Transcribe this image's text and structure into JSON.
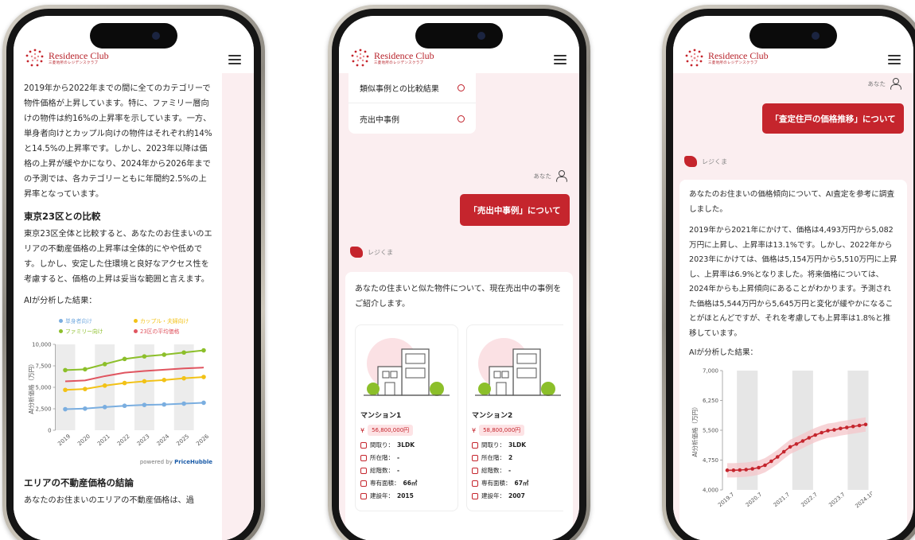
{
  "brand": {
    "title": "Residence Club",
    "subtitle": "三菱地所のレジデンスクラブ",
    "color": "#c5252d"
  },
  "phone1": {
    "intro": "2019年から2022年までの間に全てのカテゴリーで物件価格が上昇しています。特に、ファミリー層向けの物件は約16%の上昇率を示しています。一方、単身者向けとカップル向けの物件はそれぞれ約14%と14.5%の上昇率です。しかし、2023年以降は価格の上昇が緩やかになり、2024年から2026年までの予測では、各カテゴリーともに年間約2.5%の上昇率となっています。",
    "section1_title": "東京23区との比較",
    "section1_text": "東京23区全体と比較すると、あなたのお住まいのエリアの不動産価格の上昇率は全体的にやや低めです。しかし、安定した住環境と良好なアクセス性を考慮すると、価格の上昇は妥当な範囲と言えます。",
    "analysis_label": "AIが分析した結果：",
    "powered_by": "powered by",
    "powered_brand": "PriceHubble",
    "section2_title": "エリアの不動産価格の結論",
    "section2_text": "あなたのお住まいのエリアの不動産価格は、過"
  },
  "phone2": {
    "menu_items": [
      "類似事例との比較結果",
      "売出中事例"
    ],
    "you_label": "あなた",
    "user_message": "「売出中事例」について",
    "bot_name": "レジくま",
    "bot_message": "あなたの住まいと似た物件について、現在売出中の事例をご紹介します。",
    "properties": [
      {
        "name": "マンション1",
        "price": "56,800,000円",
        "layout_label": "間取り：",
        "layout": "3LDK",
        "floor_label": "所在階：",
        "floor": "-",
        "total_floors_label": "総階数：",
        "total_floors": "-",
        "area_label": "専有面積：",
        "area": "66㎡",
        "built_label": "建設年：",
        "built": "2015"
      },
      {
        "name": "マンション2",
        "price": "58,800,000円",
        "layout_label": "間取り：",
        "layout": "3LDK",
        "floor_label": "所在階：",
        "floor": "2",
        "total_floors_label": "総階数：",
        "total_floors": "-",
        "area_label": "専有面積：",
        "area": "67㎡",
        "built_label": "建設年：",
        "built": "2007"
      }
    ],
    "yen": "¥"
  },
  "phone3": {
    "you_label": "あなた",
    "user_message": "「査定住戸の価格推移」について",
    "bot_name": "レジくま",
    "para1": "あなたのお住まいの価格傾向について、AI査定を参考に調査しました。",
    "para2": "2019年から2021年にかけて、価格は4,493万円から5,082万円に上昇し、上昇率は13.1%です。しかし、2022年から2023年にかけては、価格は5,154万円から5,510万円に上昇し、上昇率は6.9%となりました。将来価格については、2024年からも上昇傾向にあることがわかります。予測された価格は5,544万円から5,645万円と変化が緩やかになることがほとんどですが、それを考慮しても上昇率は1.8%と推移しています。",
    "analysis_label": "AIが分析した結果："
  },
  "chart_data": [
    {
      "type": "line",
      "ylabel": "AI分析価格（万円）",
      "x": [
        "2019",
        "2020",
        "2021",
        "2022",
        "2023",
        "2024",
        "2025",
        "2026"
      ],
      "ylim": [
        0,
        10000
      ],
      "yticks": [
        "0",
        "2,500",
        "5,000",
        "7,500",
        "10,000"
      ],
      "series": [
        {
          "name": "単身者向け",
          "color": "#7aaee0",
          "values": [
            2450,
            2520,
            2700,
            2850,
            2950,
            3000,
            3100,
            3200
          ]
        },
        {
          "name": "カップル・夫婦向け",
          "color": "#f2c216",
          "values": [
            4700,
            4800,
            5200,
            5500,
            5700,
            5850,
            6050,
            6200
          ]
        },
        {
          "name": "ファミリー向け",
          "color": "#8cbf2a",
          "values": [
            7000,
            7100,
            7700,
            8300,
            8600,
            8800,
            9050,
            9300
          ]
        },
        {
          "name": "23区の平均価格",
          "color": "#e05560",
          "values": [
            5700,
            5800,
            6300,
            6700,
            6900,
            7050,
            7200,
            7300
          ]
        }
      ]
    },
    {
      "type": "line",
      "ylabel": "AI分析価格（万円）",
      "x": [
        "2019.7",
        "2020.7",
        "2021.7",
        "2022.7",
        "2023.7",
        "2024.10"
      ],
      "ylim": [
        4000,
        7000
      ],
      "yticks": [
        "4,000",
        "4,750",
        "5,500",
        "6,250",
        "7,000"
      ],
      "series": [
        {
          "color": "#c5252d",
          "values": [
            4493,
            4493,
            4500,
            4510,
            4530,
            4560,
            4620,
            4720,
            4830,
            4960,
            5082,
            5154,
            5230,
            5310,
            5380,
            5440,
            5490,
            5510,
            5544,
            5570,
            5595,
            5620,
            5645
          ]
        }
      ]
    }
  ]
}
